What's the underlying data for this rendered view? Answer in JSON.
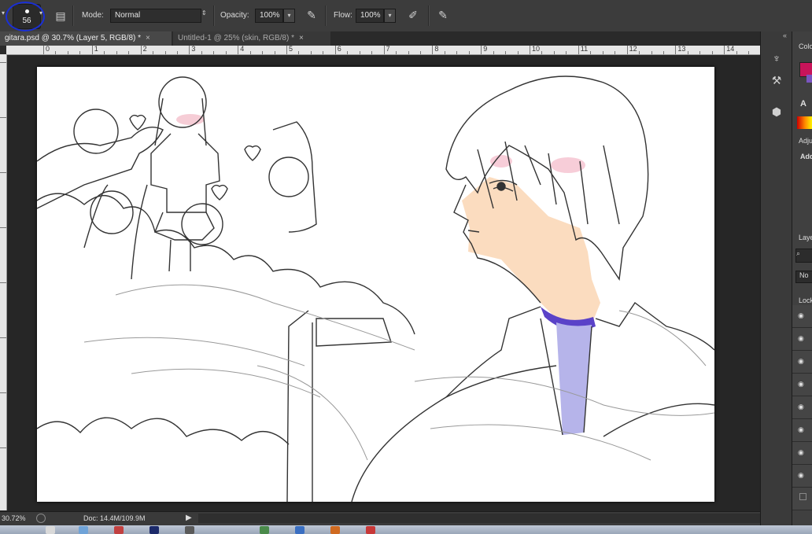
{
  "options_bar": {
    "brush_size": "56",
    "mode_label": "Mode:",
    "mode_value": "Normal",
    "opacity_label": "Opacity:",
    "opacity_value": "100%",
    "flow_label": "Flow:",
    "flow_value": "100%"
  },
  "tabs": [
    {
      "label": "gitara.psd @ 30.7% (Layer 5, RGB/8) *",
      "active": true
    },
    {
      "label": "Untitled-1 @ 25% (skin, RGB/8) *",
      "active": false
    }
  ],
  "ruler": {
    "h_numbers": [
      "0",
      "1",
      "2",
      "3",
      "4",
      "5",
      "6",
      "7",
      "8",
      "9",
      "10",
      "11",
      "12",
      "13",
      "14"
    ],
    "v_numbers": [
      "1",
      "2",
      "3",
      "4",
      "5",
      "6",
      "7",
      "8"
    ]
  },
  "status": {
    "zoom": "30.72%",
    "doc": "Doc: 14.4M/109.9M"
  },
  "panels": {
    "color_tab": "Colo",
    "adjustments_tab": "Adju",
    "adjustments_add": "Add",
    "layers_tab": "Laye",
    "blend_mode": "No",
    "lock_label": "Lock"
  },
  "colors": {
    "foreground": "#c8145a",
    "background": "#7a55c0",
    "skin": "#fbdcbf",
    "shirt_collar": "#5a42c8",
    "shirt_undershirt": "#b6b4ea"
  }
}
